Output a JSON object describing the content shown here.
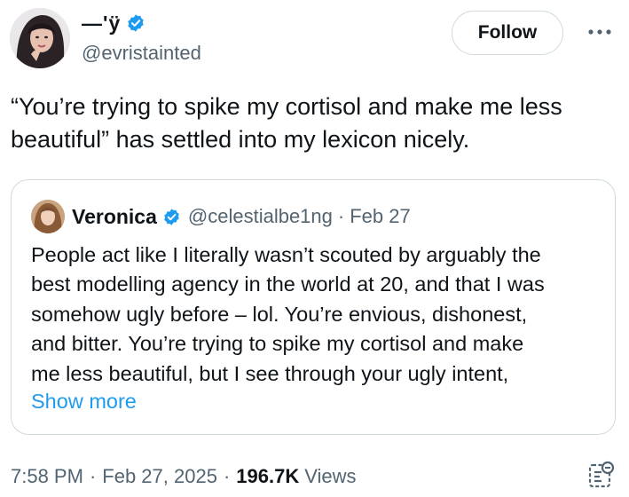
{
  "author": {
    "display_name": "—'ÿ",
    "handle": "@evristainted",
    "verified": true,
    "avatar_icon": "profile-photo"
  },
  "follow_label": "Follow",
  "more_icon": "more-options-icon",
  "tweet": {
    "line1": "“You’re trying to spike my cortisol and make me less",
    "line2": "beautiful” has settled into my lexicon nicely."
  },
  "quote": {
    "name": "Veronica",
    "verified": true,
    "handle": "@celestialbe1ng",
    "separator": "·",
    "date": "Feb 27",
    "lines": [
      "People act like I literally wasn’t scouted by arguably the",
      "best modelling agency in the world at 20, and that I was",
      "somehow ugly before – lol. You’re envious, dishonest,",
      "and bitter. You’re trying to spike my cortisol and make",
      "me less beautiful, but I see through your ugly intent,"
    ],
    "show_more": "Show more"
  },
  "meta": {
    "time": "7:58 PM",
    "separator": "·",
    "date": "Feb 27, 2025",
    "views_count": "196.7K",
    "views_label": "Views"
  },
  "colors": {
    "verified_blue": "#1d9bf0",
    "link_blue": "#1d9bf0",
    "secondary_text": "#536471",
    "border": "#cfd9de"
  }
}
